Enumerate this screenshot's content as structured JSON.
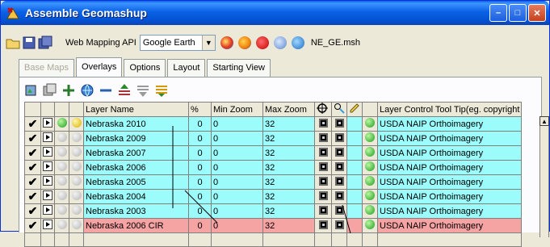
{
  "window": {
    "title": "Assemble Geomashup"
  },
  "toolbar": {
    "api_label": "Web Mapping API",
    "api_select_value": "Google Earth",
    "filename": "NE_GE.msh"
  },
  "tabs": [
    {
      "label": "Base Maps",
      "state": "disabled"
    },
    {
      "label": "Overlays",
      "state": "active"
    },
    {
      "label": "Options",
      "state": "normal"
    },
    {
      "label": "Layout",
      "state": "normal"
    },
    {
      "label": "Starting View",
      "state": "normal"
    }
  ],
  "grid": {
    "headers": {
      "layer_name": "Layer Name",
      "percent": "%",
      "min_zoom": "Min Zoom",
      "max_zoom": "Max Zoom",
      "tooltip": "Layer Control Tool Tip(eg. copyright"
    },
    "rows": [
      {
        "name": "Nebraska 2010",
        "pct": "0",
        "min": "0",
        "max": "32",
        "tooltip": "USDA NAIP Orthoimagery",
        "color": "cyan",
        "active": true
      },
      {
        "name": "Nebraska 2009",
        "pct": "0",
        "min": "0",
        "max": "32",
        "tooltip": "USDA NAIP Orthoimagery",
        "color": "cyan",
        "active": false
      },
      {
        "name": "Nebraska 2007",
        "pct": "0",
        "min": "0",
        "max": "32",
        "tooltip": "USDA NAIP Orthoimagery",
        "color": "cyan",
        "active": false
      },
      {
        "name": "Nebraska 2006",
        "pct": "0",
        "min": "0",
        "max": "32",
        "tooltip": "USDA NAIP Orthoimagery",
        "color": "cyan",
        "active": false
      },
      {
        "name": "Nebraska 2005",
        "pct": "0",
        "min": "0",
        "max": "32",
        "tooltip": "USDA NAIP Orthoimagery",
        "color": "cyan",
        "active": false
      },
      {
        "name": "Nebraska 2004",
        "pct": "0",
        "min": "0",
        "max": "32",
        "tooltip": "USDA NAIP Orthoimagery",
        "color": "cyan",
        "active": false
      },
      {
        "name": "Nebraska 2003",
        "pct": "0",
        "min": "0",
        "max": "32",
        "tooltip": "USDA NAIP Orthoimagery",
        "color": "cyan",
        "active": false
      },
      {
        "name": "Nebraska 2006 CIR",
        "pct": "0",
        "min": "0",
        "max": "32",
        "tooltip": "USDA NAIP Orthoimagery",
        "color": "pink",
        "active": false
      }
    ]
  },
  "colors": {
    "row_cyan": "#9cfcfc",
    "row_pink": "#f5a3a3",
    "title_bar": "#0b62e5"
  }
}
